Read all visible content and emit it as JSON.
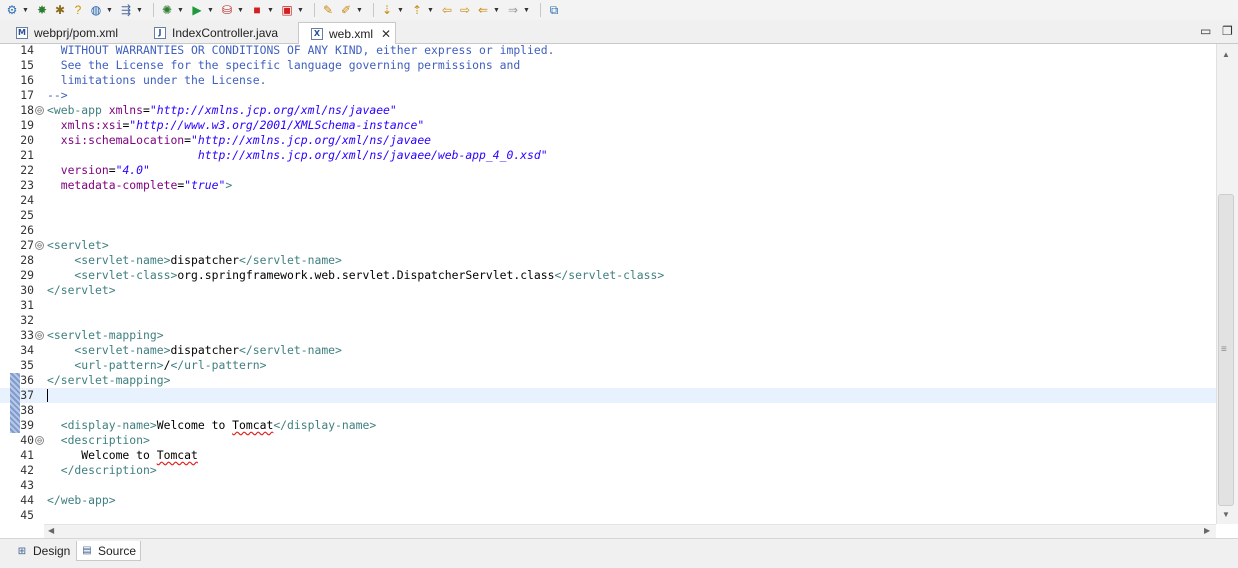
{
  "toolbar": {
    "icons": [
      "settings-icon",
      "build-icon",
      "bug-icon",
      "help-icon",
      "globe-icon",
      "run-icon",
      "external-tools-icon",
      "stop-icon",
      "open-icon",
      "link-icon",
      "next-annotation-icon",
      "prev-annotation-icon",
      "last-edit-icon",
      "back-icon",
      "forward-icon",
      "new-window-icon"
    ]
  },
  "tabs": [
    {
      "label": "webprj/pom.xml",
      "icon": "M"
    },
    {
      "label": "IndexController.java",
      "icon": "J"
    },
    {
      "label": "web.xml",
      "icon": "X",
      "close": "✕"
    }
  ],
  "window_controls": {
    "minimize": "▭",
    "maximize": "❐"
  },
  "editor": {
    "lines": [
      {
        "n": "14",
        "parts": [
          {
            "t": "  WITHOUT WARRANTIES OR CONDITIONS OF ANY KIND, either express or implied.",
            "c": "comment"
          }
        ]
      },
      {
        "n": "15",
        "parts": [
          {
            "t": "  See the License for the specific language governing permissions and",
            "c": "comment"
          }
        ]
      },
      {
        "n": "16",
        "parts": [
          {
            "t": "  limitations under the License.",
            "c": "comment"
          }
        ]
      },
      {
        "n": "17",
        "parts": [
          {
            "t": "-->",
            "c": "comment"
          }
        ]
      },
      {
        "n": "18",
        "fold": "⊖",
        "parts": [
          {
            "t": "<web-app ",
            "c": "tag"
          },
          {
            "t": "xmlns",
            "c": "attr"
          },
          {
            "t": "=",
            "c": "text"
          },
          {
            "t": "\"http://xmlns.jcp.org/xml/ns/javaee\"",
            "c": "val"
          }
        ]
      },
      {
        "n": "19",
        "parts": [
          {
            "t": "  xmlns:xsi",
            "c": "attr"
          },
          {
            "t": "=",
            "c": "text"
          },
          {
            "t": "\"http://www.w3.org/2001/XMLSchema-instance\"",
            "c": "val"
          }
        ]
      },
      {
        "n": "20",
        "parts": [
          {
            "t": "  xsi:schemaLocation",
            "c": "attr"
          },
          {
            "t": "=",
            "c": "text"
          },
          {
            "t": "\"http://xmlns.jcp.org/xml/ns/javaee",
            "c": "val"
          }
        ]
      },
      {
        "n": "21",
        "parts": [
          {
            "t": "                      http://xmlns.jcp.org/xml/ns/javaee/web-app_4_0.xsd\"",
            "c": "val"
          }
        ]
      },
      {
        "n": "22",
        "parts": [
          {
            "t": "  version",
            "c": "attr"
          },
          {
            "t": "=",
            "c": "text"
          },
          {
            "t": "\"4.0\"",
            "c": "val"
          }
        ]
      },
      {
        "n": "23",
        "parts": [
          {
            "t": "  metadata-complete",
            "c": "attr"
          },
          {
            "t": "=",
            "c": "text"
          },
          {
            "t": "\"true\"",
            "c": "val"
          },
          {
            "t": ">",
            "c": "tag"
          }
        ]
      },
      {
        "n": "24",
        "parts": []
      },
      {
        "n": "25",
        "parts": []
      },
      {
        "n": "26",
        "parts": []
      },
      {
        "n": "27",
        "fold": "⊖",
        "parts": [
          {
            "t": "<servlet>",
            "c": "tag"
          }
        ]
      },
      {
        "n": "28",
        "parts": [
          {
            "t": "    <servlet-name>",
            "c": "tag"
          },
          {
            "t": "dispatcher",
            "c": "text"
          },
          {
            "t": "</servlet-name>",
            "c": "tag"
          }
        ]
      },
      {
        "n": "29",
        "parts": [
          {
            "t": "    <servlet-class>",
            "c": "tag"
          },
          {
            "t": "org.springframework.web.servlet.DispatcherServlet.class",
            "c": "text"
          },
          {
            "t": "</servlet-class>",
            "c": "tag"
          }
        ]
      },
      {
        "n": "30",
        "parts": [
          {
            "t": "</servlet>",
            "c": "tag"
          }
        ]
      },
      {
        "n": "31",
        "parts": []
      },
      {
        "n": "32",
        "parts": []
      },
      {
        "n": "33",
        "fold": "⊖",
        "parts": [
          {
            "t": "<servlet-mapping>",
            "c": "tag"
          }
        ]
      },
      {
        "n": "34",
        "parts": [
          {
            "t": "    <servlet-name>",
            "c": "tag"
          },
          {
            "t": "dispatcher",
            "c": "text"
          },
          {
            "t": "</servlet-name>",
            "c": "tag"
          }
        ]
      },
      {
        "n": "35",
        "parts": [
          {
            "t": "    <url-pattern>",
            "c": "tag"
          },
          {
            "t": "/",
            "c": "text"
          },
          {
            "t": "</url-pattern>",
            "c": "tag"
          }
        ]
      },
      {
        "n": "36",
        "parts": [
          {
            "t": "</servlet-mapping>",
            "c": "tag"
          }
        ]
      },
      {
        "n": "37",
        "current": true,
        "parts": []
      },
      {
        "n": "38",
        "parts": []
      },
      {
        "n": "39",
        "parts": [
          {
            "t": "  <display-name>",
            "c": "tag"
          },
          {
            "t": "Welcome to ",
            "c": "text"
          },
          {
            "t": "Tomcat",
            "c": "text",
            "sq": true
          },
          {
            "t": "</display-name>",
            "c": "tag"
          }
        ]
      },
      {
        "n": "40",
        "fold": "⊖",
        "parts": [
          {
            "t": "  <description>",
            "c": "tag"
          }
        ]
      },
      {
        "n": "41",
        "parts": [
          {
            "t": "     Welcome to ",
            "c": "text"
          },
          {
            "t": "Tomcat",
            "c": "text",
            "sq": true
          }
        ]
      },
      {
        "n": "42",
        "parts": [
          {
            "t": "  </description>",
            "c": "tag"
          }
        ]
      },
      {
        "n": "43",
        "parts": []
      },
      {
        "n": "44",
        "parts": [
          {
            "t": "</web-app>",
            "c": "tag"
          }
        ]
      },
      {
        "n": "45",
        "parts": []
      }
    ]
  },
  "bottom_tabs": [
    {
      "label": "Design",
      "icon": "grid-icon",
      "glyph": "⊞"
    },
    {
      "label": "Source",
      "icon": "source-icon",
      "glyph": "▤"
    }
  ],
  "colors": {
    "comment": "#3f5fbf",
    "tag": "#3f7f7f",
    "attr": "#7f007f",
    "value": "#2a00ff",
    "current_line": "#e8f2fe"
  }
}
